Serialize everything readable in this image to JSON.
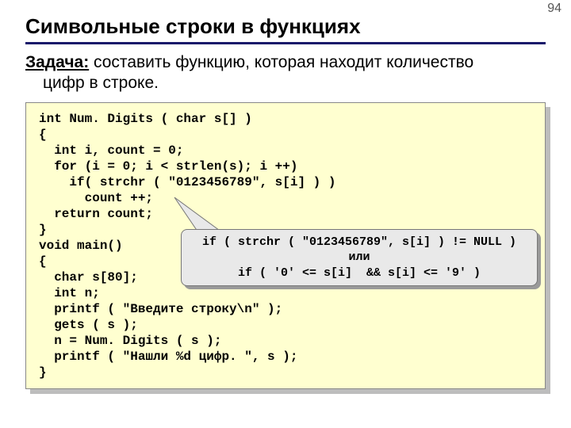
{
  "page_number": "94",
  "title": "Символьные строки в функциях",
  "task": {
    "label": "Задача:",
    "line1_rest": " составить функцию, которая находит количество",
    "line2": "цифр в строке."
  },
  "code": "int Num. Digits ( char s[] )\n{\n  int i, count = 0;\n  for (i = 0; i < strlen(s); i ++)\n    if( strchr ( \"0123456789\", s[i] ) )\n      count ++;\n  return count;\n}\nvoid main()\n{\n  char s[80];\n  int n;\n  printf ( \"Введите строку\\n\" );\n  gets ( s );\n  n = Num. Digits ( s );\n  printf ( \"Нашли %d цифр. \", s );\n}",
  "callout": {
    "line1": "if ( strchr ( \"0123456789\", s[i] ) != NULL )",
    "line2": "или",
    "line3": "if ( '0' <= s[i]  && s[i] <= '9' )"
  }
}
